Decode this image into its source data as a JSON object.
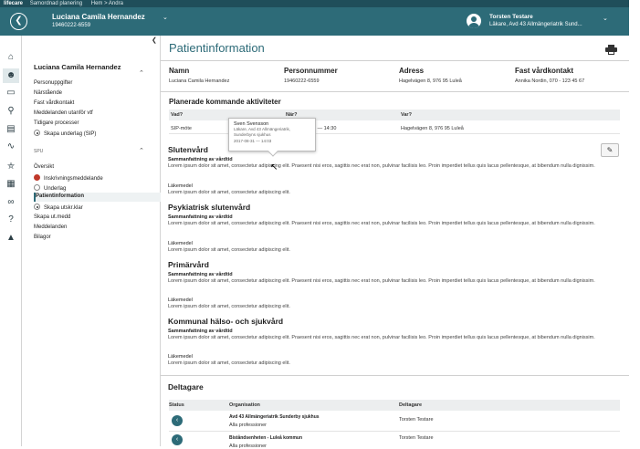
{
  "topbar": {
    "brand": "lifecare",
    "app": "Samordnad planering",
    "crumb": "Hem > Andra"
  },
  "header": {
    "back_icon": "back-arrow-icon",
    "patient_name": "Luciana Camila Hernandez",
    "patient_id": "19460222-6559",
    "user_name": "Torsten Testare",
    "user_role": "Läkare, Avd 43 Allmängeriatrik Sund..."
  },
  "rail": {
    "icons": [
      "home-icon",
      "person-icon",
      "inbox-icon",
      "search-icon",
      "document-icon",
      "chart-icon",
      "cart-icon",
      "form-icon",
      "link-icon",
      "help-icon",
      "graduation-cap-icon"
    ]
  },
  "sidebar": {
    "patient_name": "Luciana Camila Hernandez",
    "items": [
      {
        "label": "Personuppgifter"
      },
      {
        "label": "Närstående"
      },
      {
        "label": "Fast vårdkontakt"
      },
      {
        "label": "Meddelanden utanför vtf"
      },
      {
        "label": "Tidigare processer"
      },
      {
        "label": "Skapa underlag (SIP)"
      }
    ],
    "section_label": "SPU",
    "process_items": [
      {
        "label": "Översikt"
      },
      {
        "label": "Inskrivningsmeddelande"
      },
      {
        "label": "Underlag"
      },
      {
        "label": "Patientinformation"
      },
      {
        "label": "Skapa utskr.klar"
      },
      {
        "label": "Skapa ut.medd"
      },
      {
        "label": "Meddelanden"
      },
      {
        "label": "Bilagor"
      }
    ]
  },
  "main": {
    "title": "Patientinformation",
    "info": {
      "name_label": "Namn",
      "name_value": "Luciana Camila Hernandez",
      "pnr_label": "Personnummer",
      "pnr_value": "19460222-6559",
      "address_label": "Adress",
      "address_value": "Hagelvägen 8, 976 95 Luleå",
      "contact_label": "Fast vårdkontakt",
      "contact_value": "Annika Nordin, 070 - 123 45 67"
    },
    "planned": {
      "heading": "Planerade kommande aktiviteter",
      "col_what": "Vad?",
      "col_when": "När?",
      "col_where": "Var?",
      "row_what": "SIP-möte",
      "row_when": "3 — 14:30",
      "row_where": "Hagelvägen 8, 976 95 Luleå"
    },
    "popover": {
      "name": "Sven Svensson",
      "role": "Läkare, Avd 43 Allmängeriatrik, Sunderbyns sjukhus",
      "time": "2017-08-31 — 14:03"
    },
    "sections": [
      {
        "heading": "Slutenvård",
        "summary_label": "Sammanfattning av vårdtid",
        "summary_text": "Lorem ipsum dolor sit amet, consectetur adipiscing elit. Praesent nisi eros, sagittis nec erat non, pulvinar facilisis leo. Proin imperdiet tellus quis lacus pellentesque, at bibendum nulla dignissim.",
        "med_label": "Läkemedel",
        "med_text": "Lorem ipsum dolor sit amet, consectetur adipiscing elit."
      },
      {
        "heading": "Psykiatrisk slutenvård",
        "summary_label": "Sammanfattning av vårdtid",
        "summary_text": "Lorem ipsum dolor sit amet, consectetur adipiscing elit. Praesent nisi eros, sagittis nec erat non, pulvinar facilisis leo. Proin imperdiet tellus quis lacus pellentesque, at bibendum nulla dignissim.",
        "med_label": "Läkemedel",
        "med_text": "Lorem ipsum dolor sit amet, consectetur adipiscing elit."
      },
      {
        "heading": "Primärvård",
        "summary_label": "Sammanfattning av vårdtid",
        "summary_text": "Lorem ipsum dolor sit amet, consectetur adipiscing elit. Praesent nisi eros, sagittis nec erat non, pulvinar facilisis leo. Proin imperdiet tellus quis lacus pellentesque, at bibendum nulla dignissim.",
        "med_label": "Läkemedel",
        "med_text": "Lorem ipsum dolor sit amet, consectetur adipiscing elit."
      },
      {
        "heading": "Kommunal hälso- och sjukvård",
        "summary_label": "Sammanfattning av vårdtid",
        "summary_text": "Lorem ipsum dolor sit amet, consectetur adipiscing elit. Praesent nisi eros, sagittis nec erat non, pulvinar facilisis leo. Proin imperdiet tellus quis lacus pellentesque, at bibendum nulla dignissim.",
        "med_label": "Läkemedel",
        "med_text": "Lorem ipsum dolor sit amet, consectetur adipiscing elit."
      }
    ],
    "participants": {
      "heading": "Deltagare",
      "col_status": "Status",
      "col_org": "Organisation",
      "col_part": "Deltagare",
      "rows": [
        {
          "org": "Avd 43 Allmängeriatrik Sunderby sjukhus",
          "sub": "Alla professioner",
          "participant": "Torsten Testare"
        },
        {
          "org": "Biståndsenheten - Luleå kommun",
          "sub": "Alla professioner",
          "participant": "Torsten Testare"
        }
      ]
    }
  }
}
